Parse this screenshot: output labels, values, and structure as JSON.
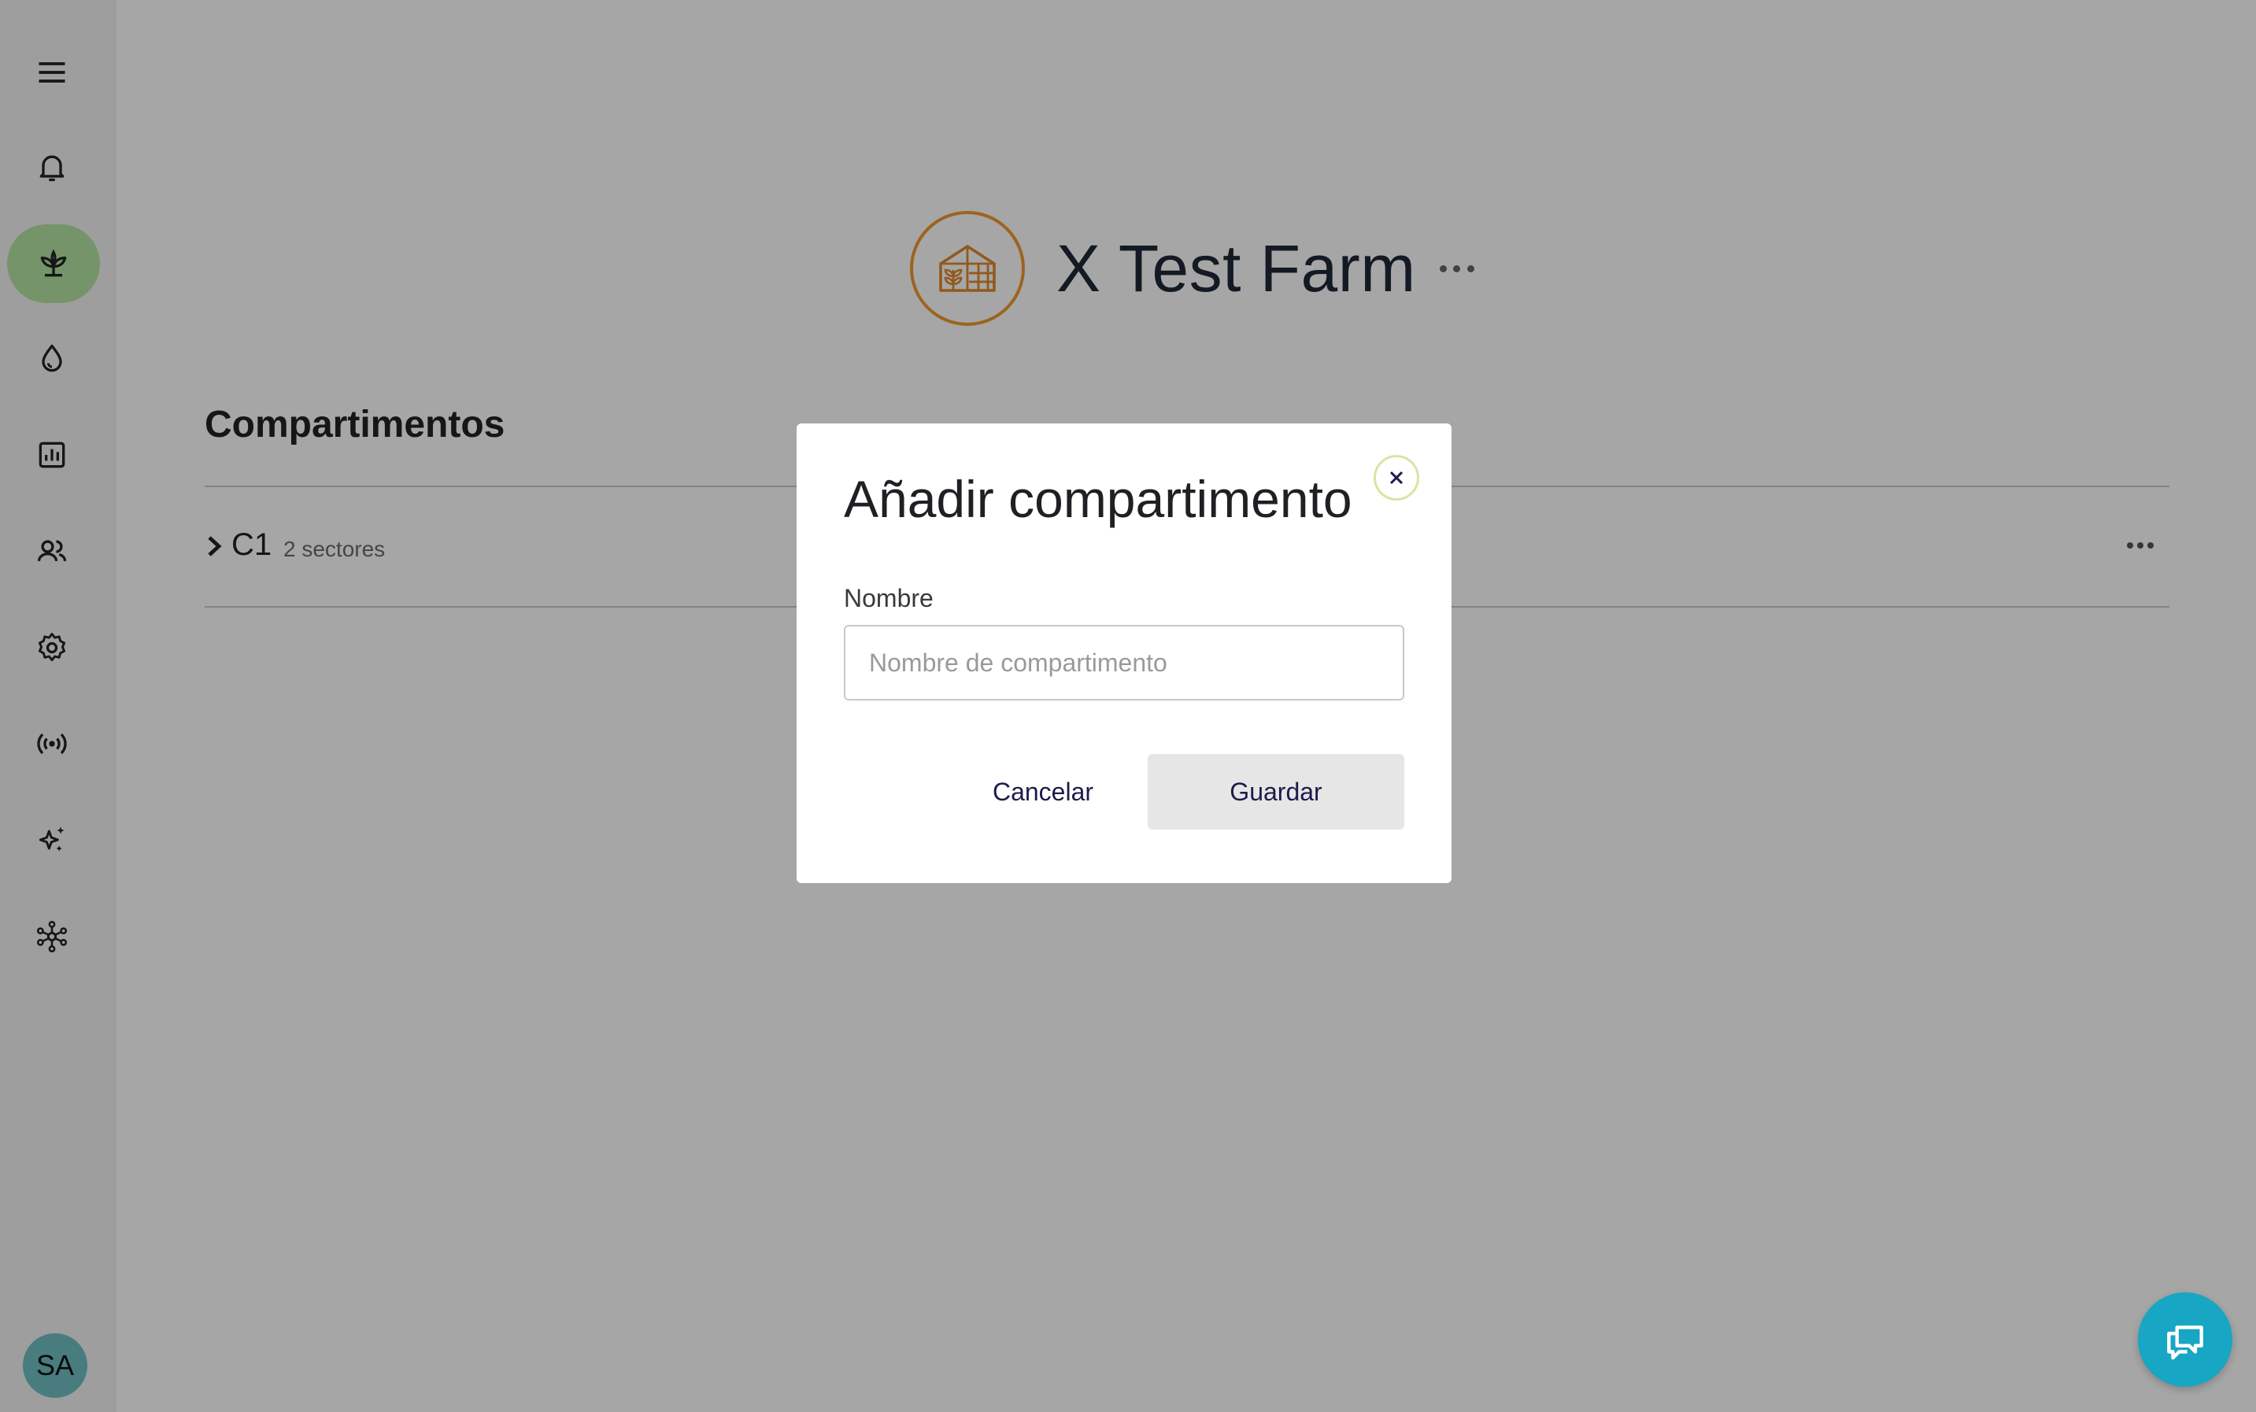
{
  "sidebar": {
    "avatar_initials": "SA",
    "items": [
      {
        "icon": "menu-icon"
      },
      {
        "icon": "bell-icon"
      },
      {
        "icon": "plant-icon",
        "active": true
      },
      {
        "icon": "water-drop-icon"
      },
      {
        "icon": "chart-icon"
      },
      {
        "icon": "users-icon"
      },
      {
        "icon": "gear-icon"
      },
      {
        "icon": "signal-icon"
      },
      {
        "icon": "sparkles-icon"
      },
      {
        "icon": "network-icon"
      }
    ],
    "active_color": "#b6e3a1"
  },
  "farm": {
    "name": "X Test Farm",
    "logo_icon": "greenhouse-icon",
    "logo_color": "#f29a2e"
  },
  "compartments": {
    "title": "Compartimentos",
    "rows": [
      {
        "name": "C1",
        "meta": "2 sectores"
      }
    ]
  },
  "modal": {
    "title": "Añadir compartimento",
    "field_label": "Nombre",
    "field_placeholder": "Nombre de compartimento",
    "field_value": "",
    "cancel_label": "Cancelar",
    "save_label": "Guardar"
  },
  "chat": {
    "icon": "chat-icon",
    "color": "#17a6c3"
  }
}
